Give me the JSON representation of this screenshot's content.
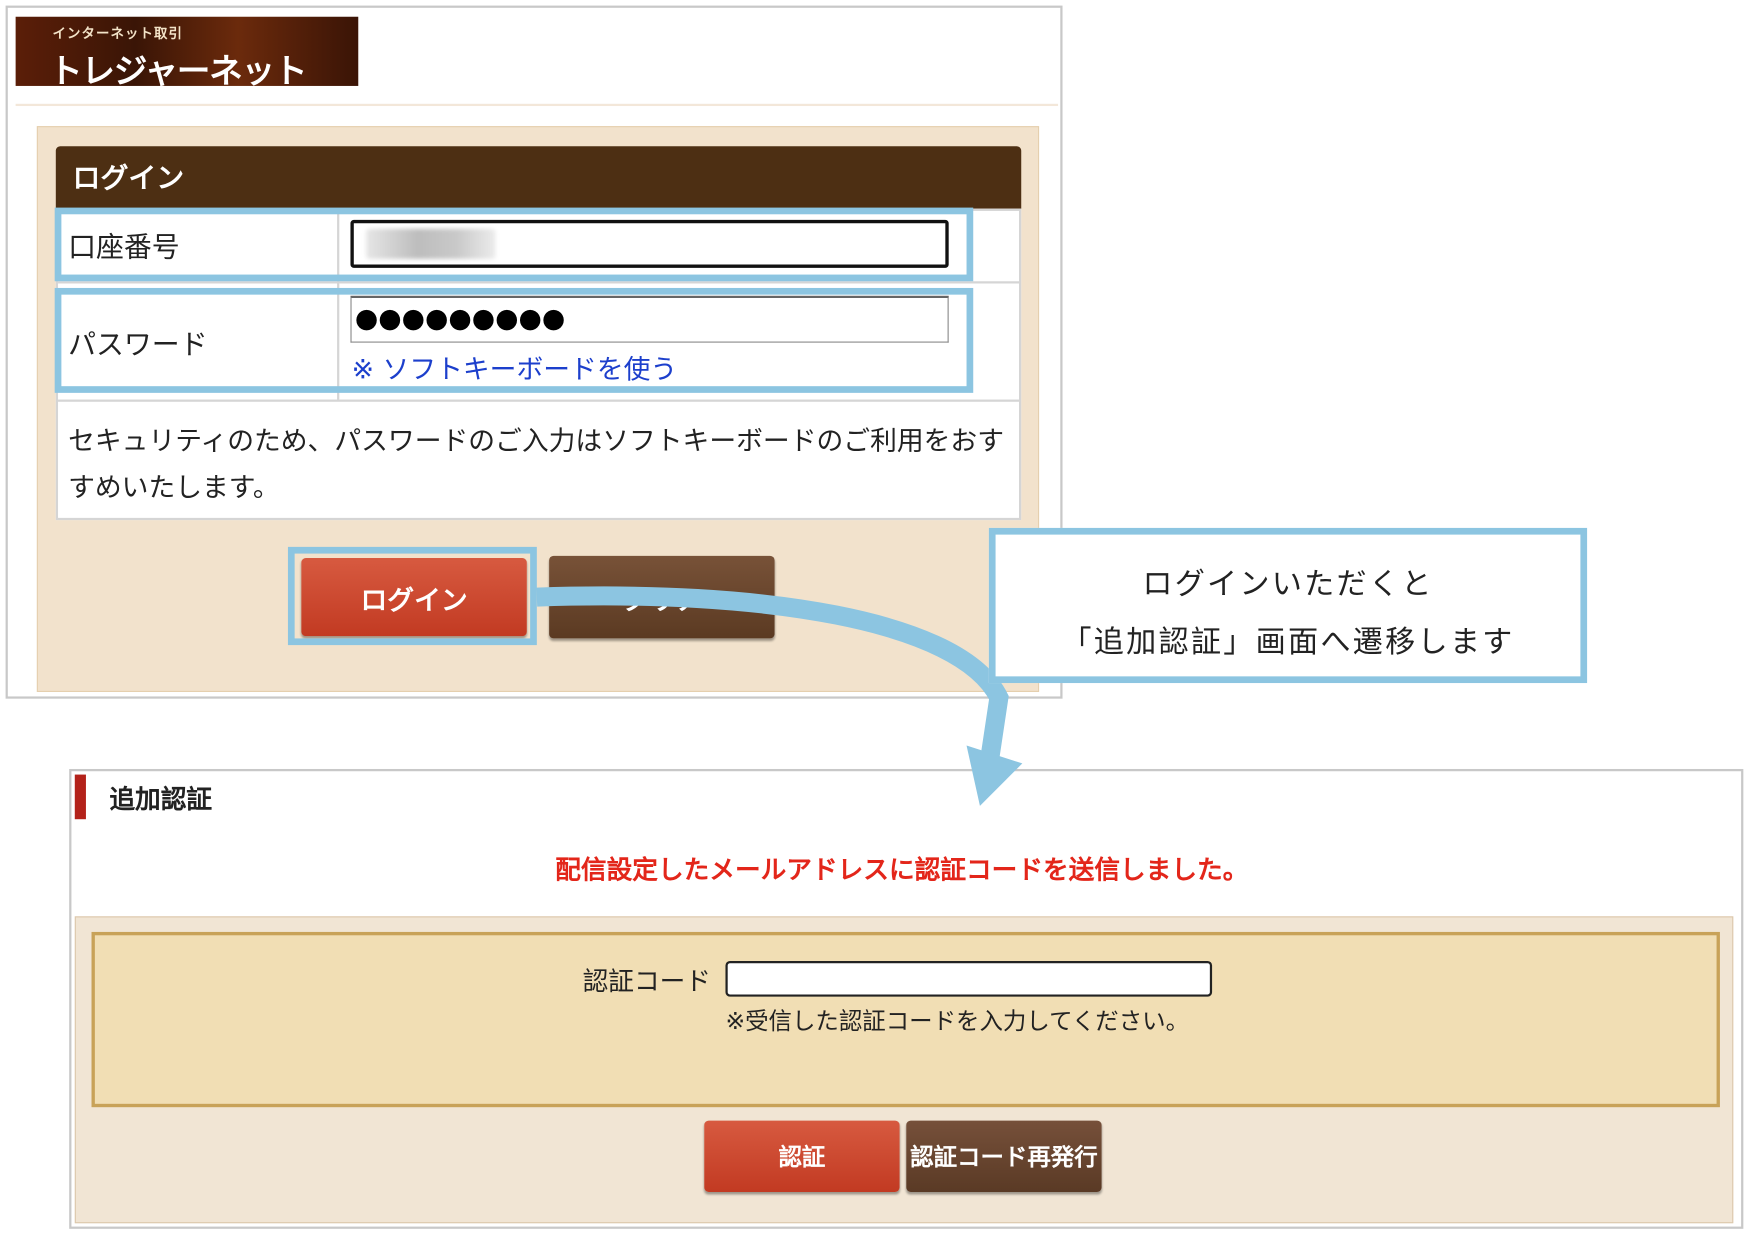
{
  "login_window": {
    "logo": {
      "subtitle": "インターネット取引",
      "name": "トレジャーネット"
    },
    "panel_title": "ログイン",
    "account": {
      "label": "口座番号",
      "value": ""
    },
    "password": {
      "label": "パスワード",
      "masked_value": "●●●●●●●●●",
      "softkey_link": "※ ソフトキーボードを使う"
    },
    "notice": "セキュリティのため、パスワードのご入力はソフトキーボードのご利用をおすすめいたします。",
    "buttons": {
      "login": "ログイン",
      "clear": "クリア"
    }
  },
  "callout": {
    "line1": "ログインいただくと",
    "line2": "「追加認証」画面へ遷移します"
  },
  "auth_window": {
    "title": "追加認証",
    "message": "配信設定したメールアドレスに認証コードを送信しました。",
    "code": {
      "label": "認証コード",
      "value": "",
      "hint": "※受信した認証コードを入力してください。"
    },
    "buttons": {
      "verify": "認証",
      "reissue": "認証コード再発行"
    }
  },
  "colors": {
    "highlight": "#8cc5e1",
    "header_brown": "#4d2f13",
    "login_red": "#c23a22",
    "message_red": "#e3261a",
    "link_blue": "#1c3fcc"
  },
  "icons": [
    "flow-arrow-icon"
  ]
}
